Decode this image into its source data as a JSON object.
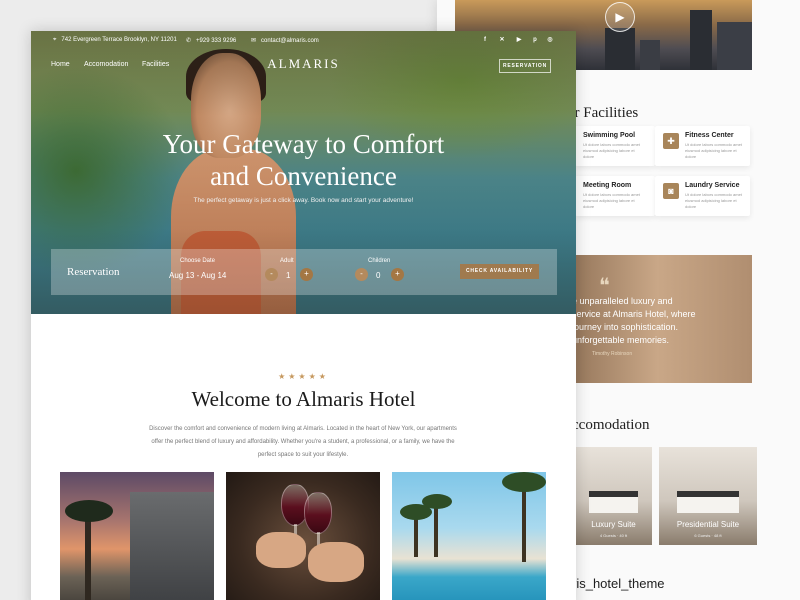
{
  "colors": {
    "accent": "#a07a4e",
    "star": "#c6985e",
    "text_dark": "#1b1b1b"
  },
  "topbar": {
    "address": "742 Evergreen Terrace Brooklyn, NY 11201",
    "phone": "+929 333 9296",
    "email": "contact@almaris.com",
    "social_icons": [
      "facebook-icon",
      "x-icon",
      "youtube-icon",
      "pinterest-icon",
      "instagram-icon"
    ]
  },
  "nav": {
    "items": [
      "Home",
      "Accomodation",
      "Facilities"
    ],
    "logo": "ALMARIS",
    "reservation_button": "RESERVATION"
  },
  "hero": {
    "title_line1": "Your Gateway to Comfort",
    "title_line2": "and Convenience",
    "subtitle": "The perfect getaway is just a click away. Book now and start your adventure!"
  },
  "reservation": {
    "title": "Reservation",
    "date_label": "Choose Date",
    "date_value": "Aug 13 - Aug 14",
    "adult_label": "Adult",
    "adult_value": "1",
    "children_label": "Children",
    "children_value": "0",
    "minus": "-",
    "plus": "+",
    "check_button": "CHECK AVAILABILITY"
  },
  "welcome": {
    "stars": "★★★★★",
    "title": "Welcome to Almaris Hotel",
    "description": "Discover the comfort and convenience of modern living at Almaris. Located in the heart of New York, our apartments offer the perfect blend of luxury and affordability. Whether you're a student, a professional, or a family, we have the perfect space to suit your lifestyle."
  },
  "back_page": {
    "facilities_title": "ur Facilities",
    "facilities": [
      {
        "name": "Swimming Pool",
        "desc": "Ut dolore labors commodo amet eiusmod adipisicing labore et dolore"
      },
      {
        "name": "Fitness Center",
        "desc": "Ut dolore labors commodo amet eiusmod adipisicing labore et dolore"
      },
      {
        "name": "Meeting Room",
        "desc": "Ut dolore labors commodo amet eiusmod adipisicing labore et dolore"
      },
      {
        "name": "Laundry Service",
        "desc": "Ut dolore labors commodo amet eiusmod adipisicing labore et dolore"
      }
    ],
    "testimonial": {
      "text": "e unparalleled luxury and service at Almaris Hotel, where journey into sophistication. unforgettable memories.",
      "author": "Timothy Robinson"
    },
    "accommodation_title": "ccomodation",
    "rooms": [
      {
        "name": "Luxury Suite",
        "meta": "4 Guests · 40 ft"
      },
      {
        "name": "Presidential Suite",
        "meta": "6 Guests · 48 ft"
      }
    ],
    "instagram": "ris_hotel_theme"
  }
}
